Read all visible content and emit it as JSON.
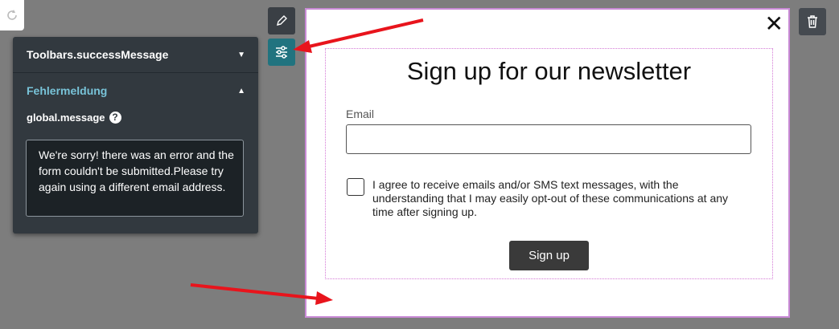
{
  "panel": {
    "title": "Toolbars.successMessage",
    "section": "Fehlermeldung",
    "field_label": "global.message",
    "help": "?",
    "message": "We're sorry! there was an error and the form couldn't be submitted.Please try again using a different email address."
  },
  "modal": {
    "title": "Sign up for our newsletter",
    "email_label": "Email",
    "email_value": "",
    "consent": "I agree to receive emails and/or SMS text messages, with the understanding that I may easily opt-out of these communications at any time after signing up.",
    "button": "Sign up",
    "close": "✕"
  },
  "icons": {
    "redo": "redo-icon",
    "pencil": "pencil-icon",
    "settings": "sliders-icon",
    "trash": "trash-icon"
  },
  "colors": {
    "panel_bg": "#32393f",
    "accent": "#78c3d8",
    "active_tool": "#21737f",
    "annotation_arrow": "#e8141c",
    "modal_border": "#c98ad6"
  }
}
